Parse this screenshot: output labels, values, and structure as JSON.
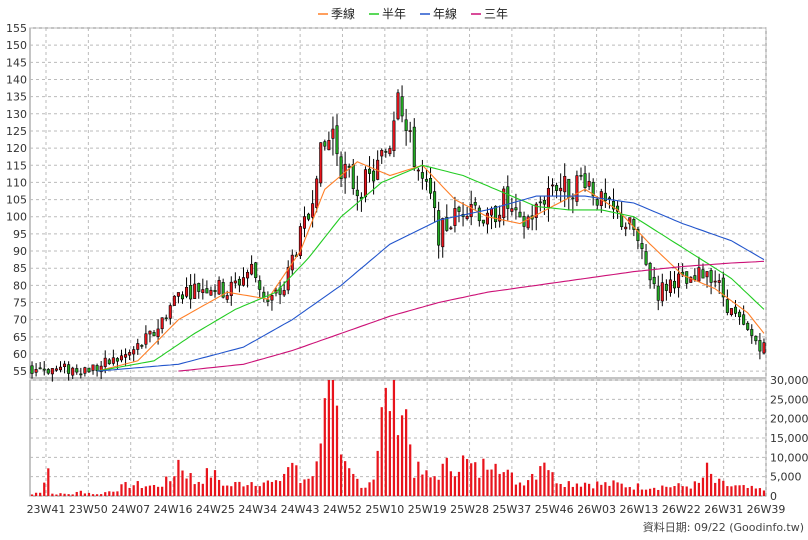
{
  "chart_data": {
    "type": "candlestick",
    "legend": [
      {
        "name": "季線",
        "color": "#ff7f27"
      },
      {
        "name": "半年",
        "color": "#22cc22"
      },
      {
        "name": "年線",
        "color": "#2255cc"
      },
      {
        "name": "三年",
        "color": "#cc1177"
      }
    ],
    "price_axis": {
      "min": 53,
      "max": 155,
      "ticks": [
        55,
        60,
        65,
        70,
        75,
        80,
        85,
        90,
        95,
        100,
        105,
        110,
        115,
        120,
        125,
        130,
        135,
        140,
        145,
        150,
        155
      ]
    },
    "volume_axis": {
      "min": 0,
      "max": 30000,
      "ticks": [
        0,
        5000,
        10000,
        15000,
        20000,
        25000,
        30000
      ],
      "tick_labels": [
        "0",
        "5,000",
        "10,000",
        "15,000",
        "20,000",
        "25,000",
        "30,000"
      ]
    },
    "x_ticks": [
      "23W41",
      "23W50",
      "24W07",
      "24W16",
      "24W25",
      "24W34",
      "24W43",
      "24W52",
      "25W10",
      "25W19",
      "25W28",
      "25W37",
      "25W46",
      "26W03",
      "26W13",
      "26W22",
      "26W31",
      "26W39"
    ],
    "close_anchors": [
      [
        0,
        56
      ],
      [
        8,
        55.5
      ],
      [
        16,
        56
      ],
      [
        24,
        60
      ],
      [
        30,
        66
      ],
      [
        36,
        78
      ],
      [
        44,
        80
      ],
      [
        48,
        78
      ],
      [
        54,
        85
      ],
      [
        58,
        75
      ],
      [
        62,
        79
      ],
      [
        64,
        88
      ],
      [
        68,
        100
      ],
      [
        70,
        115
      ],
      [
        74,
        125
      ],
      [
        76,
        115
      ],
      [
        80,
        108
      ],
      [
        84,
        112
      ],
      [
        88,
        122
      ],
      [
        90,
        140
      ],
      [
        92,
        125
      ],
      [
        96,
        110
      ],
      [
        98,
        105
      ],
      [
        100,
        95
      ],
      [
        104,
        100
      ],
      [
        108,
        105
      ],
      [
        112,
        98
      ],
      [
        116,
        105
      ],
      [
        120,
        97
      ],
      [
        124,
        102
      ],
      [
        128,
        110
      ],
      [
        132,
        108
      ],
      [
        136,
        112
      ],
      [
        140,
        104
      ],
      [
        144,
        100
      ],
      [
        148,
        96
      ],
      [
        150,
        88
      ],
      [
        154,
        78
      ],
      [
        158,
        82
      ],
      [
        162,
        80
      ],
      [
        166,
        85
      ],
      [
        168,
        82
      ],
      [
        172,
        72
      ],
      [
        176,
        66
      ],
      [
        180,
        62
      ]
    ],
    "ma_quarter": [
      [
        16,
        55
      ],
      [
        26,
        58
      ],
      [
        36,
        70
      ],
      [
        48,
        78
      ],
      [
        58,
        76
      ],
      [
        66,
        90
      ],
      [
        72,
        108
      ],
      [
        80,
        116
      ],
      [
        88,
        112
      ],
      [
        96,
        115
      ],
      [
        104,
        105
      ],
      [
        112,
        100
      ],
      [
        120,
        98
      ],
      [
        128,
        103
      ],
      [
        136,
        108
      ],
      [
        144,
        102
      ],
      [
        152,
        92
      ],
      [
        160,
        83
      ],
      [
        168,
        79
      ],
      [
        176,
        72
      ],
      [
        180,
        66
      ]
    ],
    "ma_halfyear": [
      [
        16,
        55
      ],
      [
        30,
        58
      ],
      [
        40,
        66
      ],
      [
        50,
        73
      ],
      [
        60,
        78
      ],
      [
        68,
        88
      ],
      [
        76,
        100
      ],
      [
        86,
        110
      ],
      [
        96,
        115
      ],
      [
        106,
        112
      ],
      [
        116,
        107
      ],
      [
        124,
        103
      ],
      [
        132,
        102
      ],
      [
        140,
        102
      ],
      [
        148,
        100
      ],
      [
        156,
        94
      ],
      [
        164,
        88
      ],
      [
        172,
        82
      ],
      [
        180,
        73
      ]
    ],
    "ma_year": [
      [
        16,
        55
      ],
      [
        36,
        57
      ],
      [
        52,
        62
      ],
      [
        64,
        70
      ],
      [
        76,
        80
      ],
      [
        88,
        92
      ],
      [
        100,
        99
      ],
      [
        112,
        102
      ],
      [
        124,
        106
      ],
      [
        136,
        106
      ],
      [
        148,
        104
      ],
      [
        160,
        98
      ],
      [
        172,
        93
      ],
      [
        180,
        87.5
      ]
    ],
    "ma_3year": [
      [
        36,
        55
      ],
      [
        52,
        57
      ],
      [
        64,
        61
      ],
      [
        76,
        66
      ],
      [
        88,
        71
      ],
      [
        100,
        75
      ],
      [
        112,
        78
      ],
      [
        124,
        80
      ],
      [
        136,
        82
      ],
      [
        148,
        84
      ],
      [
        160,
        85.5
      ],
      [
        172,
        86.5
      ],
      [
        180,
        87
      ]
    ],
    "volume_anchors": [
      [
        0,
        400
      ],
      [
        2,
        1200
      ],
      [
        4,
        7500
      ],
      [
        5,
        600
      ],
      [
        10,
        500
      ],
      [
        12,
        1200
      ],
      [
        16,
        400
      ],
      [
        20,
        1500
      ],
      [
        24,
        3000
      ],
      [
        30,
        2500
      ],
      [
        34,
        4000
      ],
      [
        36,
        9000
      ],
      [
        40,
        3500
      ],
      [
        44,
        6000
      ],
      [
        48,
        2500
      ],
      [
        52,
        3500
      ],
      [
        56,
        4000
      ],
      [
        60,
        3000
      ],
      [
        64,
        9000
      ],
      [
        66,
        3500
      ],
      [
        70,
        7500
      ],
      [
        72,
        31000
      ],
      [
        74,
        26000
      ],
      [
        76,
        8000
      ],
      [
        78,
        6000
      ],
      [
        82,
        2500
      ],
      [
        84,
        5500
      ],
      [
        86,
        20000
      ],
      [
        88,
        27000
      ],
      [
        90,
        26000
      ],
      [
        92,
        21000
      ],
      [
        94,
        7000
      ],
      [
        98,
        4500
      ],
      [
        102,
        7500
      ],
      [
        106,
        9000
      ],
      [
        110,
        6000
      ],
      [
        114,
        12500
      ],
      [
        116,
        6000
      ],
      [
        120,
        3500
      ],
      [
        124,
        6500
      ],
      [
        126,
        11000
      ],
      [
        128,
        5000
      ],
      [
        132,
        3500
      ],
      [
        136,
        3500
      ],
      [
        140,
        3000
      ],
      [
        144,
        3000
      ],
      [
        148,
        2500
      ],
      [
        152,
        2500
      ],
      [
        156,
        2500
      ],
      [
        160,
        2500
      ],
      [
        164,
        3000
      ],
      [
        166,
        6500
      ],
      [
        168,
        3500
      ],
      [
        172,
        2500
      ],
      [
        176,
        2000
      ],
      [
        180,
        1500
      ]
    ],
    "candle_count": 181
  },
  "source": "資料日期: 09/22 (Goodinfo.tw)"
}
